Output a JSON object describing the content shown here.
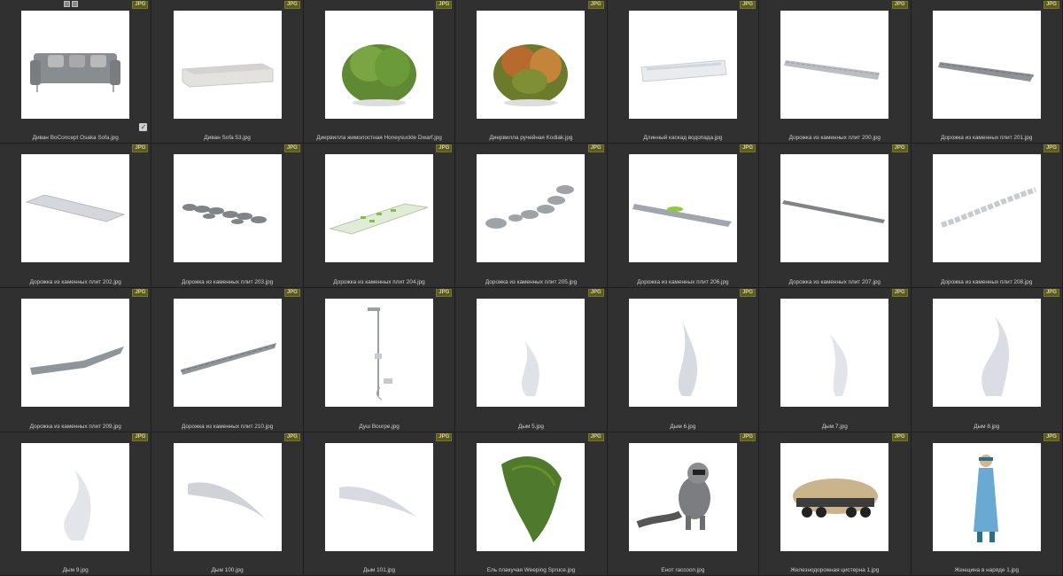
{
  "badge_label": "JPG",
  "items": [
    {
      "name": "Диван BoConcept Osaka Sofa.jpg",
      "art": "sofa-grey"
    },
    {
      "name": "Диван Sofa 53.jpg",
      "art": "sofa-white"
    },
    {
      "name": "Диервилла жимолостная Honeysuckle Dwarf.jpg",
      "art": "shrub-green"
    },
    {
      "name": "Диервилла ручейная Kodiak.jpg",
      "art": "shrub-autumn"
    },
    {
      "name": "Длинный каскад водопада.jpg",
      "art": "cascade"
    },
    {
      "name": "Дорожка из каменных плит 200.jpg",
      "art": "path-long"
    },
    {
      "name": "Дорожка из каменных плит 201.jpg",
      "art": "path-dark"
    },
    {
      "name": "Дорожка из каменных плит 202.jpg",
      "art": "path-wide"
    },
    {
      "name": "Дорожка из каменных плит 203.jpg",
      "art": "path-stones"
    },
    {
      "name": "Дорожка из каменных плит 204.jpg",
      "art": "path-grass"
    },
    {
      "name": "Дорожка из каменных плит 205.jpg",
      "art": "path-stepping"
    },
    {
      "name": "Дорожка из каменных плит 206.jpg",
      "art": "path-green"
    },
    {
      "name": "Дорожка из каменных плит 207.jpg",
      "art": "path-thin"
    },
    {
      "name": "Дорожка из каменных плит 208.jpg",
      "art": "path-curve"
    },
    {
      "name": "Дорожка из каменных плит 209.jpg",
      "art": "path-blocks"
    },
    {
      "name": "Дорожка из каменных плит 210.jpg",
      "art": "path-slabs"
    },
    {
      "name": "Душ Bourpe.jpg",
      "art": "shower"
    },
    {
      "name": "Дым 5.jpg",
      "art": "smoke-a"
    },
    {
      "name": "Дым 6.jpg",
      "art": "smoke-b"
    },
    {
      "name": "Дым 7.jpg",
      "art": "smoke-c"
    },
    {
      "name": "Дым 8.jpg",
      "art": "smoke-d"
    },
    {
      "name": "Дым 9.jpg",
      "art": "smoke-e"
    },
    {
      "name": "Дым 100.jpg",
      "art": "smoke-plume"
    },
    {
      "name": "Дым 101.jpg",
      "art": "smoke-plume2"
    },
    {
      "name": "Ель плакучая Weeping Spruce.jpg",
      "art": "spruce"
    },
    {
      "name": "Енот raccoon.jpg",
      "art": "raccoon"
    },
    {
      "name": "Железнодорожная цистерна 1.jpg",
      "art": "tank"
    },
    {
      "name": "Женщина в наряде 1.jpg",
      "art": "woman"
    }
  ]
}
